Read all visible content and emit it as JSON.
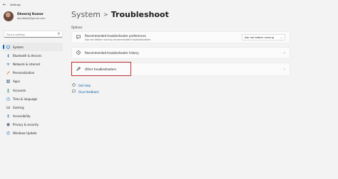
{
  "window": {
    "title": "Settings",
    "back_icon": "back-arrow-icon"
  },
  "profile": {
    "name": "Dheeraj Kumar",
    "email": "abcdfeijkl@gmail.com"
  },
  "search": {
    "placeholder": "Find a setting",
    "icon": "search-icon"
  },
  "nav": {
    "items": [
      {
        "label": "System",
        "icon": "monitor-icon",
        "active": true
      },
      {
        "label": "Bluetooth & devices",
        "icon": "bluetooth-icon"
      },
      {
        "label": "Network & internet",
        "icon": "wifi-icon"
      },
      {
        "label": "Personalization",
        "icon": "brush-icon"
      },
      {
        "label": "Apps",
        "icon": "apps-icon"
      },
      {
        "label": "Accounts",
        "icon": "person-icon"
      },
      {
        "label": "Time & language",
        "icon": "clock-globe-icon"
      },
      {
        "label": "Gaming",
        "icon": "gamepad-icon"
      },
      {
        "label": "Accessibility",
        "icon": "accessibility-icon"
      },
      {
        "label": "Privacy & security",
        "icon": "shield-icon"
      },
      {
        "label": "Windows Update",
        "icon": "update-icon"
      }
    ]
  },
  "breadcrumb": {
    "parent": "System",
    "separator": ">",
    "current": "Troubleshoot"
  },
  "options_label": "Options",
  "cards": {
    "prefs": {
      "title": "Recommended troubleshooter preferences",
      "subtitle": "Ask me before running recommended troubleshooters",
      "dropdown_value": "Ask me before running",
      "icon": "chat-bubble-icon"
    },
    "history": {
      "title": "Recommended troubleshooter history",
      "icon": "history-icon"
    },
    "other": {
      "title": "Other troubleshooters",
      "icon": "wrench-icon"
    }
  },
  "links": {
    "help": {
      "label": "Get help",
      "icon": "help-icon"
    },
    "feedback": {
      "label": "Give feedback",
      "icon": "feedback-icon"
    }
  },
  "colors": {
    "accent": "#0067c0",
    "highlight": "#c03232",
    "link": "#0058a6"
  }
}
